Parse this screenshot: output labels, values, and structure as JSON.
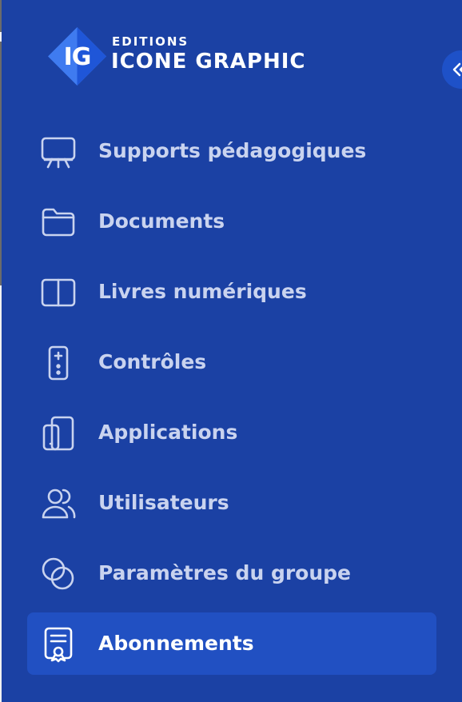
{
  "brand": {
    "logo_monogram": "IG",
    "small_text": "EDITIONS",
    "name": "ICONE GRAPHIC"
  },
  "collapse": {
    "icon": "chevrons-left-icon"
  },
  "nav": {
    "items": [
      {
        "label": "Supports pédagogiques",
        "icon": "presentation-board-icon",
        "active": false
      },
      {
        "label": "Documents",
        "icon": "folder-icon",
        "active": false
      },
      {
        "label": "Livres numériques",
        "icon": "open-book-icon",
        "active": false
      },
      {
        "label": "Contrôles",
        "icon": "game-controller-icon",
        "active": false
      },
      {
        "label": "Applications",
        "icon": "devices-icon",
        "active": false
      },
      {
        "label": "Utilisateurs",
        "icon": "users-icon",
        "active": false
      },
      {
        "label": "Paramètres du groupe",
        "icon": "overlapping-circles-icon",
        "active": false
      },
      {
        "label": "Abonnements",
        "icon": "certificate-icon",
        "active": true
      }
    ]
  },
  "colors": {
    "sidebar_background": "#1b41a4",
    "active_item_background": "#2150c2",
    "label": "#c9d3ef",
    "active_label": "#ffffff",
    "logo_light": "#3f7bf0",
    "logo_dark": "#1f56d8"
  }
}
